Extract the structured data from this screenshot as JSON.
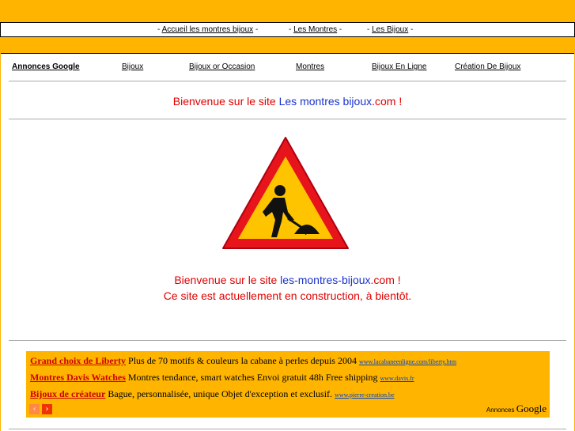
{
  "topnav": {
    "items": [
      {
        "prefix": "- ",
        "label": "Accueil les montres bijoux",
        "suffix": " -"
      },
      {
        "prefix": "- ",
        "label": "Les Montres",
        "suffix": " -"
      },
      {
        "prefix": "- ",
        "label": "Les Bijoux",
        "suffix": " -"
      }
    ]
  },
  "google_bar": {
    "label": "Annonces Google",
    "links": [
      "Bijoux",
      "Bijoux or Occasion",
      "Montres",
      "Bijoux En Ligne",
      "Création De Bijoux"
    ]
  },
  "welcome": {
    "prefix": "Bienvenue sur le site ",
    "site": "Les montres bijoux",
    "suffix": ".com !"
  },
  "sign": {
    "icon": "road-works-sign-icon",
    "colors": {
      "border": "#e8141c",
      "fill": "#ffc400",
      "figure": "#111111"
    }
  },
  "message": {
    "line1_prefix": "Bienvenue sur le site ",
    "line1_site": "les-montres-bijoux",
    "line1_suffix": ".com !",
    "line2": "Ce site est actuellement en construction, à bientôt."
  },
  "ads": [
    {
      "title": "Grand choix de Liberty",
      "text": " Plus de 70 motifs & couleurs la cabane à perles depuis 2004 ",
      "url": "www.lacabaneenligne.com/liberty.htm"
    },
    {
      "title": "Montres Davis Watches",
      "text": " Montres tendance, smart watches Envoi gratuit 48h Free shipping ",
      "url": "www.davis.fr"
    },
    {
      "title": "Bijoux de créateur",
      "text": " Bague, personnalisée, unique Objet d'exception et exclusif. ",
      "url": "www.pierre-creation.be"
    }
  ],
  "ads_footer": {
    "prev": "‹",
    "next": "›",
    "brand_prefix": "Annonces ",
    "brand": "Google"
  },
  "colors": {
    "page_bg": "#ffb500",
    "red_text": "#e00000",
    "blue_text": "#1a33cc"
  }
}
